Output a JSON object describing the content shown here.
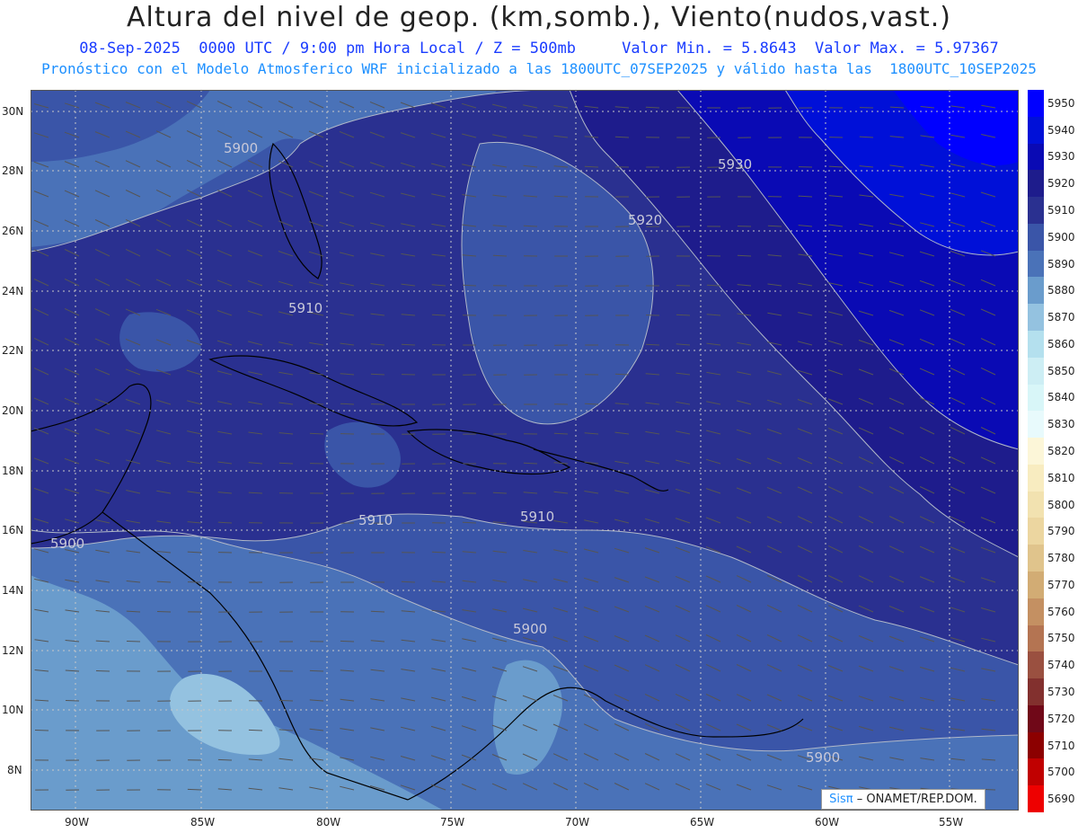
{
  "title": "Altura del nivel de geop. (km,somb.), Viento(nudos,vast.)",
  "subtitle1": "08-Sep-2025  0000 UTC / 9:00 pm Hora Local / Z = 500mb     Valor Min. = 5.8643  Valor Max. = 5.97367",
  "subtitle2": "Pronóstico con el Modelo Atmosferico WRF inicializado a las 1800UTC_07SEP2025 y válido hasta las  1800UTC_10SEP2025",
  "lat_labels": [
    "30N",
    "28N",
    "26N",
    "24N",
    "22N",
    "20N",
    "18N",
    "16N",
    "14N",
    "12N",
    "10N",
    "8N"
  ],
  "lon_labels": [
    "90W",
    "85W",
    "80W",
    "75W",
    "70W",
    "65W",
    "60W",
    "55W"
  ],
  "contour_labels": [
    "5900",
    "5930",
    "5920",
    "5910",
    "5910",
    "5910",
    "5900",
    "5900",
    "5900"
  ],
  "colorbar": {
    "levels": [
      "5950",
      "5940",
      "5930",
      "5920",
      "5910",
      "5900",
      "5890",
      "5880",
      "5870",
      "5860",
      "5850",
      "5840",
      "5830",
      "5820",
      "5810",
      "5800",
      "5790",
      "5780",
      "5770",
      "5760",
      "5750",
      "5740",
      "5730",
      "5720",
      "5710",
      "5700",
      "5690"
    ],
    "colors": [
      "#0000ff",
      "#0010d8",
      "#0a0ab4",
      "#1e1c8c",
      "#2a3090",
      "#3a55a8",
      "#4a72b8",
      "#6a9ccc",
      "#94c2e0",
      "#b4e0ee",
      "#cdeef4",
      "#d8f6f8",
      "#e8fafc",
      "#fcf6d8",
      "#f8ecc0",
      "#f2e2b0",
      "#ecd6a0",
      "#e0c48c",
      "#d2ac74",
      "#c49062",
      "#b47452",
      "#9a5040",
      "#82302e",
      "#700818",
      "#8c0000",
      "#c00000",
      "#ee0000"
    ]
  },
  "credit": {
    "brand": "Sisπ",
    "text": "– ONAMET/REP.DOM."
  }
}
